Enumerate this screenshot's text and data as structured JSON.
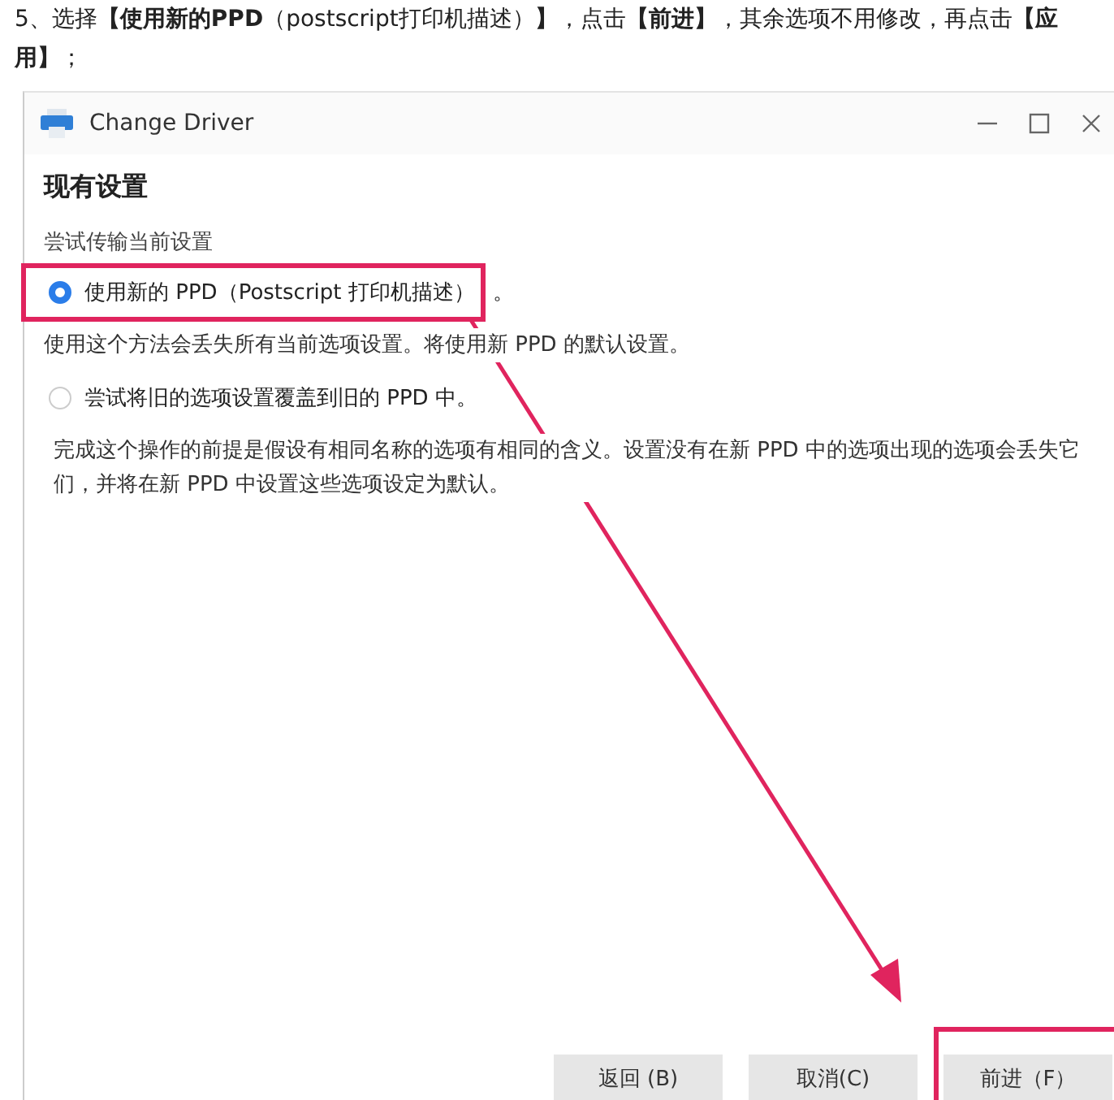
{
  "instruction": "5、选择**【使用新的PPD**（postscript打印机描述）**】**，点击**【前进】**，其余选项不用修改，再点击**【应用】**；",
  "window": {
    "title": "Change Driver"
  },
  "section_title": "现有设置",
  "group_label": "尝试传输当前设置",
  "options": [
    {
      "label": "使用新的 PPD（Postscript 打印机描述）",
      "suffix": "。",
      "selected": true,
      "highlighted": true,
      "description": "使用这个方法会丢失所有当前选项设置。将使用新 PPD 的默认设置。"
    },
    {
      "label": "尝试将旧的选项设置覆盖到旧的 PPD 中。",
      "selected": false,
      "highlighted": false,
      "description": "完成这个操作的前提是假设有相同名称的选项有相同的含义。设置没有在新 PPD 中的选项出现的选项会丢失它们，并将在新 PPD 中设置这些选项设定为默认。"
    }
  ],
  "buttons": [
    {
      "label": "返回 (B)",
      "highlighted": false
    },
    {
      "label": "取消(C)",
      "highlighted": false
    },
    {
      "label": "前进（F）",
      "highlighted": true
    }
  ]
}
